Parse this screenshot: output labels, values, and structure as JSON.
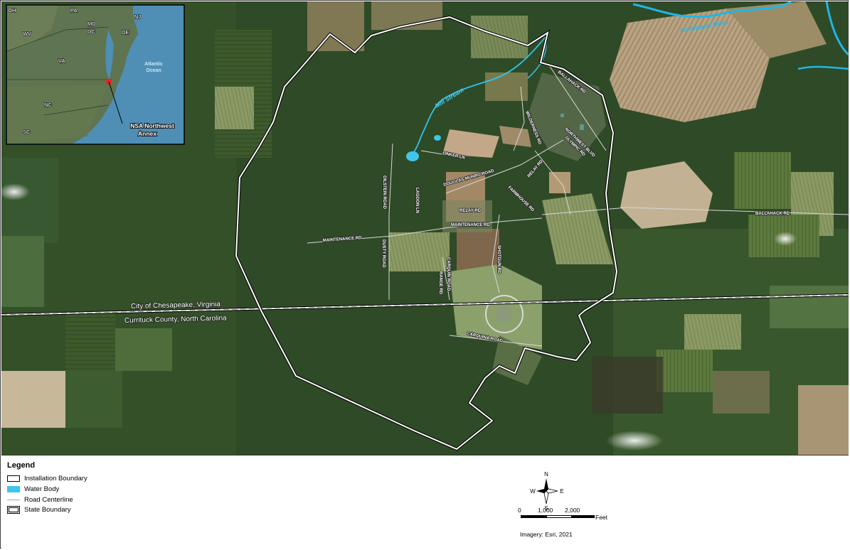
{
  "inset": {
    "states": [
      "OH",
      "PA",
      "NJ",
      "WV",
      "MD",
      "DC",
      "DE",
      "VA",
      "NC",
      "SC"
    ],
    "ocean": [
      "Atlantic",
      "Ocean"
    ],
    "callout": [
      "NSA Northwest",
      "Annex"
    ]
  },
  "rivers": {
    "northwest": "Northwest River",
    "mill": "Mill Stream"
  },
  "roads": {
    "ballahack_top": "BALLAHACK RD",
    "ballahack_right": "BALLAHACK RD",
    "wilderness": "WILDERNESS RD",
    "northwest_blvd": "NORTHWEST BLVD",
    "olympic": "OLYMPIC RD",
    "linker": "LINKER LN",
    "douglas": "DOUGLAS MUNRO ROAD",
    "relay_ne": "RELAY RD",
    "farmhouse": "FARMHOUSE RD",
    "relay": "RELAY RD",
    "maintenance_east": "MAINTENANCE RD",
    "maintenance_west": "MAINTENANCE RD",
    "oilstein": "OILSTEIN ROAD",
    "lagoon": "LAGOON LN",
    "dusty": "DUSTY ROAD",
    "carquin_nb": "CARQUIN ROAD",
    "range": "RANGE RD",
    "shotgun": "SHOTGUN RD",
    "carquin_s": "CARQUINA ROAD"
  },
  "state_line": {
    "north": "City of Chesapeake, Virginia",
    "south": "Currituck County, North Carolina"
  },
  "legend": {
    "title": "Legend",
    "items": [
      "Installation Boundary",
      "Water Body",
      "Road Centerline",
      "State Boundary"
    ]
  },
  "compass": {
    "n": "N",
    "s": "S",
    "e": "E",
    "w": "W"
  },
  "scale": {
    "ticks": [
      "0",
      "1,000",
      "2,000"
    ],
    "unit": "Feet"
  },
  "credit": "Imagery: Esri, 2021",
  "colors": {
    "water": "#3fc6ec",
    "forest": "#2f4a26",
    "field": "#8a7a5a",
    "boundary": "#ffffff",
    "inset_ocean": "#4f8fb6"
  }
}
